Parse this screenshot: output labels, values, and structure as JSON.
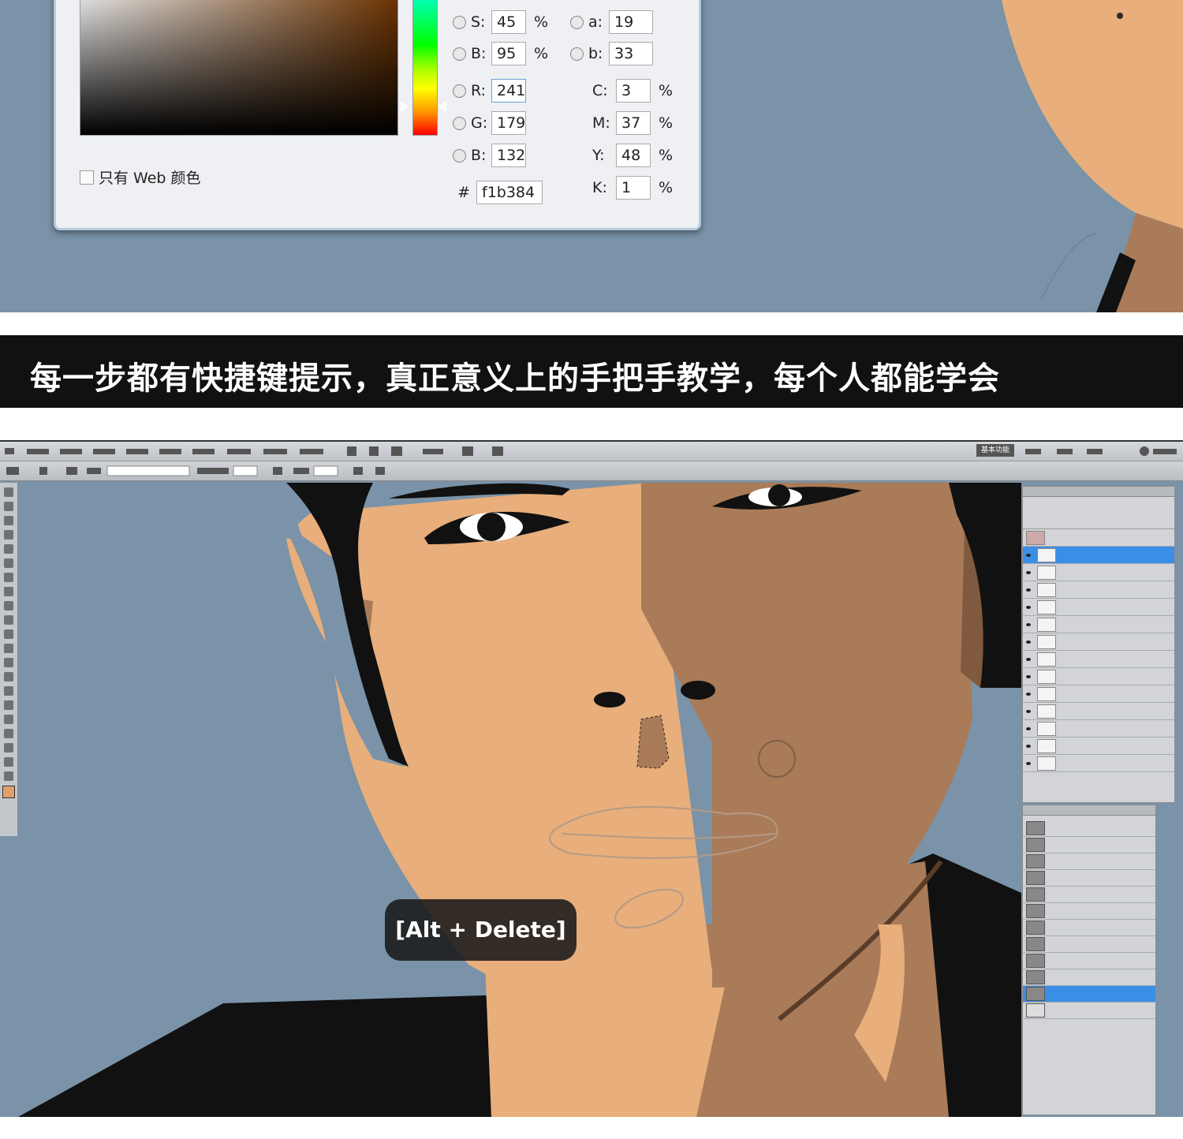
{
  "color_picker": {
    "rows_left": [
      {
        "label": "S:",
        "value": "45",
        "unit": "%"
      },
      {
        "label": "B:",
        "value": "95",
        "unit": "%"
      },
      {
        "label": "R:",
        "value": "241",
        "unit": ""
      },
      {
        "label": "G:",
        "value": "179",
        "unit": ""
      },
      {
        "label": "B:",
        "value": "132",
        "unit": ""
      }
    ],
    "rows_lab": [
      {
        "label": "a:",
        "value": "19"
      },
      {
        "label": "b:",
        "value": "33"
      }
    ],
    "rows_cmyk": [
      {
        "label": "C:",
        "value": "3",
        "unit": "%"
      },
      {
        "label": "M:",
        "value": "37",
        "unit": "%"
      },
      {
        "label": "Y:",
        "value": "48",
        "unit": "%"
      },
      {
        "label": "K:",
        "value": "1",
        "unit": "%"
      }
    ],
    "hex_label": "#",
    "hex_value": "f1b384",
    "web_only_label": "只有 Web 颜色"
  },
  "banner": {
    "text": "每一步都有快捷键提示，真正意义上的手把手教学，每个人都能学会"
  },
  "photoshop": {
    "workspace_label": "基本功能",
    "shortcut": "[Alt + Delete]"
  },
  "colors": {
    "background_blue": "#7a93a8",
    "skin_light": "#e8ae7b",
    "skin_shadow": "#a97b58",
    "selection_blue": "#3a8ee6"
  }
}
